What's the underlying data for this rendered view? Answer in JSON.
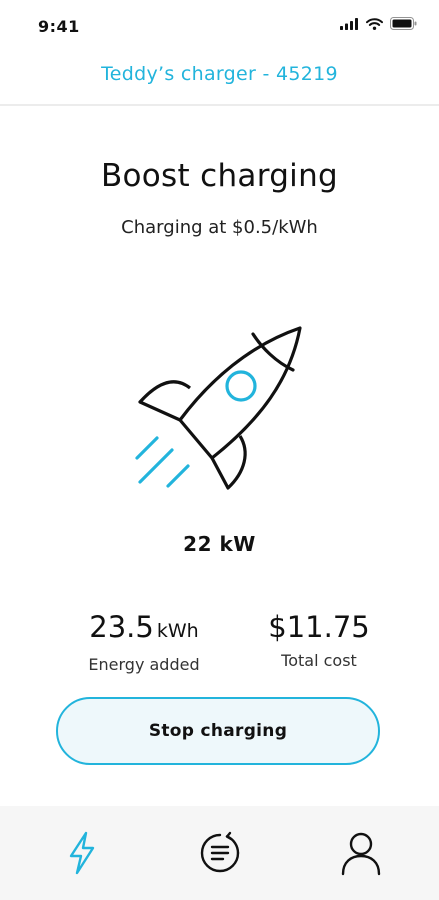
{
  "status_bar": {
    "time": "9:41",
    "icons": [
      "cellular-signal-icon",
      "wifi-icon",
      "battery-icon"
    ]
  },
  "header": {
    "title": "Teddy’s charger - 45219"
  },
  "main": {
    "title": "Boost charging",
    "subtitle": "Charging at $0.5/kWh",
    "illustration": "rocket-icon",
    "power": "22 kW",
    "stats": {
      "energy": {
        "value": "23.5",
        "unit": "kWh",
        "label": "Energy added"
      },
      "cost": {
        "value": "$11.75",
        "label": "Total cost"
      }
    },
    "stop_button_label": "Stop charging"
  },
  "tab_bar": {
    "tabs": [
      {
        "icon": "lightning-bolt-icon",
        "active": true
      },
      {
        "icon": "history-list-icon",
        "active": false
      },
      {
        "icon": "user-profile-icon",
        "active": false
      }
    ]
  },
  "colors": {
    "accent": "#22b4dc",
    "button_background": "#eef8fb",
    "tab_bar_background": "#f6f6f6",
    "text": "#111111"
  }
}
